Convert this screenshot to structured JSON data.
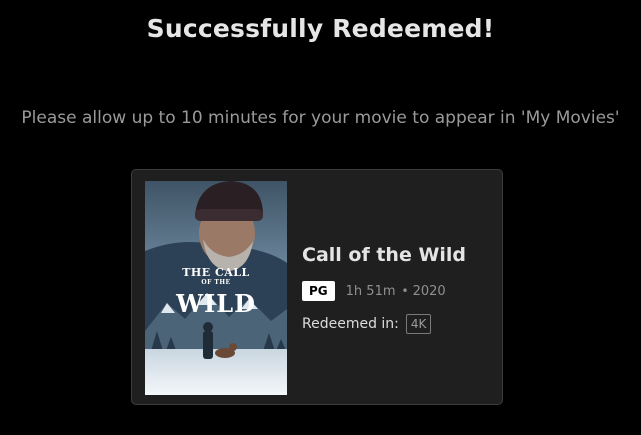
{
  "header": {
    "title": "Successfully Redeemed!",
    "message": "Please allow up to 10 minutes for your movie to appear in 'My Movies'"
  },
  "movie": {
    "title": "Call of the Wild",
    "rating": "PG",
    "runtime": "1h 51m",
    "separator": "•",
    "year": "2020",
    "redeemed_label": "Redeemed in:",
    "format": "4K",
    "poster_title_top": "THE CALL",
    "poster_title_of": "OF THE",
    "poster_title_main": "WILD"
  },
  "colors": {
    "background": "#000000",
    "card_background": "#1f1f1f",
    "card_border": "#3c3c3c",
    "title_text": "#e6e6e6",
    "muted_text": "#9a9a9a"
  }
}
